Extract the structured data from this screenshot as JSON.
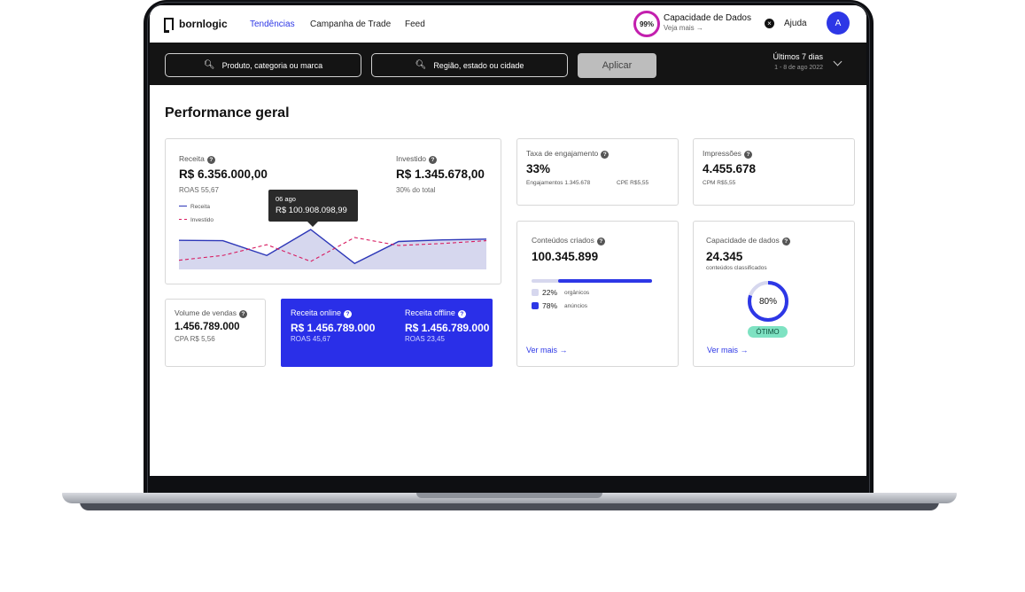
{
  "nav": {
    "logo": "bornlogic",
    "links": [
      "Tendências",
      "Campanha de Trade",
      "Feed"
    ],
    "capacity_ring": "99%",
    "capacity_title": "Capacidade de Dados",
    "capacity_link": "Veja mais →",
    "help_icon": "×",
    "help": "Ajuda",
    "avatar": "A"
  },
  "search": {
    "product_placeholder": "Produto, categoria ou marca",
    "region_placeholder": "Região, estado ou cidade",
    "apply": "Aplicar",
    "period_title": "Últimos 7 dias",
    "period_sub": "1 - 8 de ago 2022"
  },
  "page_title": "Performance geral",
  "revenue_card": {
    "receita_label": "Receita",
    "receita_value": "R$ 6.356.000,00",
    "roas": "ROAS 55,67",
    "invest_label": "Investido",
    "invest_value": "R$ 1.345.678,00",
    "invest_sub": "30% do total",
    "legend_receita": "Receita",
    "legend_investido": "Investido",
    "tooltip_date": "06 ago",
    "tooltip_value": "R$ 100.908.098,99"
  },
  "chart_data": {
    "type": "area",
    "series": [
      {
        "name": "Receita",
        "values": [
          0.73,
          0.72,
          0.35,
          1.0,
          0.15,
          0.7,
          0.74,
          0.76
        ]
      },
      {
        "name": "Investido",
        "values": [
          0.23,
          0.35,
          0.62,
          0.2,
          0.8,
          0.6,
          0.65,
          0.72
        ]
      }
    ],
    "ylim": [
      0,
      1
    ],
    "colors": {
      "receita": "#2d37b8",
      "investido": "#d81b60",
      "area": "#d6d7ee"
    }
  },
  "sales_card": {
    "label": "Volume de vendas",
    "value": "1.456.789.000",
    "sub": "CPA R$ 5,56"
  },
  "online_card": {
    "online_label": "Receita online",
    "online_value": "R$ 1.456.789.000",
    "online_roas": "ROAS 45,67",
    "offline_label": "Receita offline",
    "offline_value": "R$ 1.456.789.000",
    "offline_roas": "ROAS 23,45"
  },
  "engagement_card": {
    "label": "Taxa de engajamento",
    "value": "33%",
    "sub1": "Engajamentos 1.345.678",
    "sub2": "CPE R$5,55"
  },
  "impressions_card": {
    "label": "Impressões",
    "value": "4.455.678",
    "sub": "CPM R$5,55"
  },
  "content_card": {
    "label": "Conteúdos criados",
    "value": "100.345.899",
    "organic_pct": "22%",
    "organic_label": "orgânicos",
    "ads_pct": "78%",
    "ads_label": "anúncios",
    "organic_fraction": 0.22,
    "link": "Ver mais →"
  },
  "capacity_card": {
    "label": "Capacidade de dados",
    "value": "24.345",
    "sub": "conteúdos classificados",
    "ring_value": "80%",
    "ring_fraction": 0.8,
    "badge": "ÓTIMO",
    "link": "Ver mais →"
  }
}
